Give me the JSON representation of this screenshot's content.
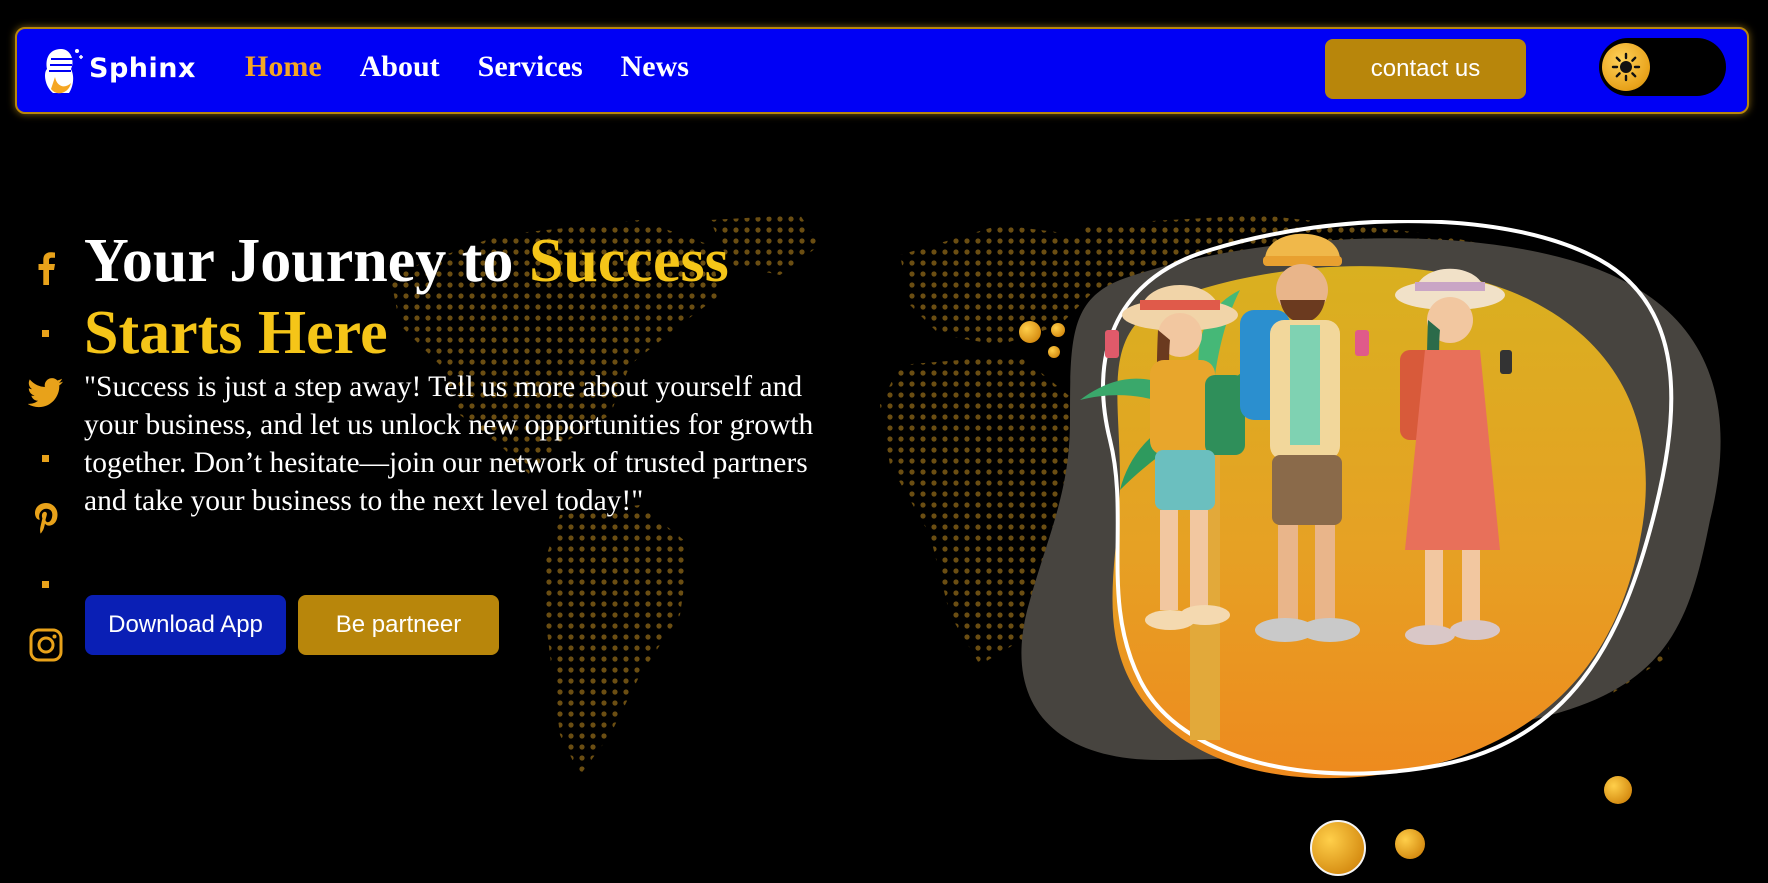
{
  "brand": {
    "name": "Sphinx"
  },
  "nav": {
    "links": [
      {
        "label": "Home",
        "active": true
      },
      {
        "label": "About",
        "active": false
      },
      {
        "label": "Services",
        "active": false
      },
      {
        "label": "News",
        "active": false
      }
    ],
    "contact_label": "contact us",
    "theme_toggle_icon": "sun-icon"
  },
  "hero": {
    "title_part1": "Your Journey to ",
    "title_accent": "Success Starts Here",
    "description": "\"Success is just a step away! Tell us more about yourself and your business, and let us unlock new opportunities for growth together. Don’t hesitate—join our network of trusted partners and take your business to the next level today!\"",
    "download_label": "Download App",
    "partner_label": "Be partneer"
  },
  "social": {
    "icons": [
      "facebook-icon",
      "twitter-icon",
      "pinterest-icon",
      "instagram-icon"
    ]
  },
  "colors": {
    "navbar_bg": "#0000f5",
    "accent_gold": "#b8860b",
    "title_accent": "#f5c518",
    "active_link": "#f5a623",
    "download_btn": "#0a1fb5",
    "background": "#000000"
  }
}
